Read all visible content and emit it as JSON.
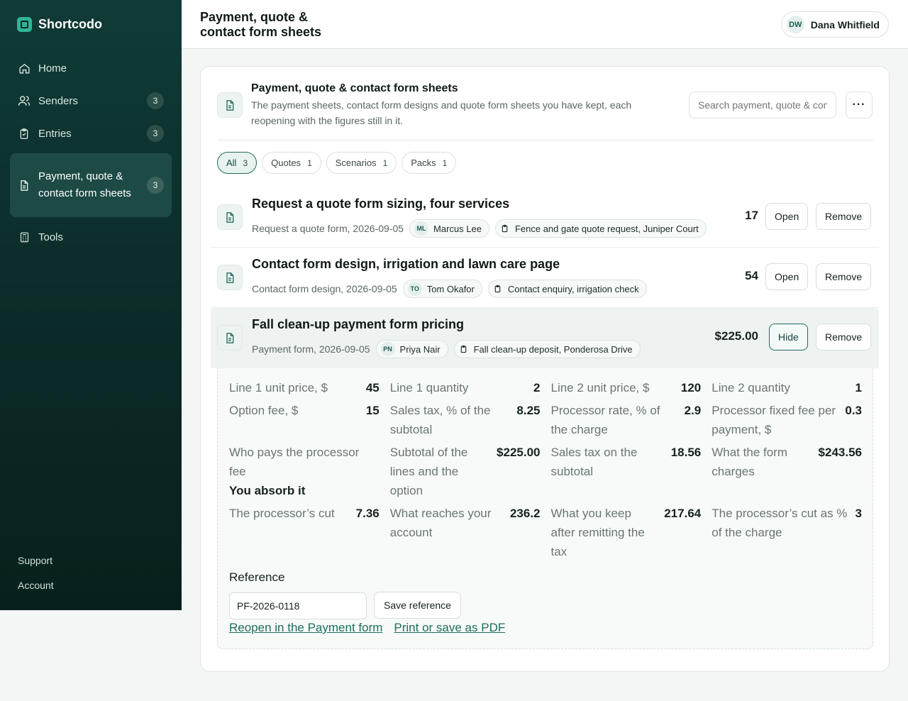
{
  "app": {
    "name": "Shortcodo"
  },
  "sidebar": {
    "items": [
      {
        "label": "Home",
        "icon": "home-icon",
        "badge": null
      },
      {
        "label": "Senders",
        "icon": "users-icon",
        "badge": "3"
      },
      {
        "label": "Entries",
        "icon": "clipboard-icon",
        "badge": "3"
      },
      {
        "label": "Payment, quote & contact form sheets",
        "icon": "document-icon",
        "badge": "3",
        "active": true
      },
      {
        "label": "Tools",
        "icon": "calculator-icon",
        "badge": null
      }
    ],
    "footer": {
      "support": "Support",
      "account": "Account"
    }
  },
  "header": {
    "title": "Payment, quote & contact form sheets",
    "user": {
      "initials": "DW",
      "name": "Dana Whitfield"
    }
  },
  "main": {
    "title": "Payment, quote & contact form sheets",
    "subtitle": "The payment sheets, contact form designs and quote form sheets you have kept, each reopening with the figures still in it.",
    "search_placeholder": "Search payment, quote & contact form sheets",
    "more_label": "···",
    "filters": [
      {
        "label": "All",
        "count": "3",
        "active": true
      },
      {
        "label": "Quotes",
        "count": "1"
      },
      {
        "label": "Scenarios",
        "count": "1"
      },
      {
        "label": "Packs",
        "count": "1"
      }
    ],
    "rows": [
      {
        "title": "Request a quote form sizing, four services",
        "meta": "Request a quote form, 2026-09-05",
        "sender_initials": "ML",
        "sender": "Marcus Lee",
        "entry": "Fence and gate quote request, Juniper Court",
        "amount": "17",
        "primary_action": "Open",
        "secondary_action": "Remove"
      },
      {
        "title": "Contact form design, irrigation and lawn care page",
        "meta": "Contact form design, 2026-09-05",
        "sender_initials": "TO",
        "sender": "Tom Okafor",
        "entry": "Contact enquiry, irrigation check",
        "amount": "54",
        "primary_action": "Open",
        "secondary_action": "Remove"
      },
      {
        "title": "Fall clean-up payment form pricing",
        "meta": "Payment form, 2026-09-05",
        "sender_initials": "PN",
        "sender": "Priya Nair",
        "entry": "Fall clean-up deposit, Ponderosa Drive",
        "amount": "$225.00",
        "primary_action": "Hide",
        "secondary_action": "Remove"
      }
    ],
    "detail": {
      "fields": [
        {
          "k": "Line 1 unit price, $",
          "v": "45"
        },
        {
          "k": "Line 1 quantity",
          "v": "2"
        },
        {
          "k": "Line 2 unit price, $",
          "v": "120"
        },
        {
          "k": "Line 2 quantity",
          "v": "1"
        },
        {
          "k": "Option fee, $",
          "v": "15"
        },
        {
          "k": "Sales tax, % of the subtotal",
          "v": "8.25"
        },
        {
          "k": "Processor rate, % of the charge",
          "v": "2.9"
        },
        {
          "k": "Processor fixed fee per payment, $",
          "v": "0.3"
        },
        {
          "k": "Who pays the processor fee",
          "v": "",
          "strong": "You absorb it"
        },
        {
          "k": "Subtotal of the lines and the option",
          "v": "$225.00"
        },
        {
          "k": "Sales tax on the subtotal",
          "v": "18.56"
        },
        {
          "k": "What the form charges",
          "v": "$243.56"
        },
        {
          "k": "The processor’s cut",
          "v": "7.36"
        },
        {
          "k": "What reaches your account",
          "v": "236.2"
        },
        {
          "k": "What you keep after remitting the tax",
          "v": "217.64"
        },
        {
          "k": "The processor’s cut as % of the charge",
          "v": "3"
        }
      ],
      "reference_label": "Reference",
      "reference_value": "PF-2026-0118",
      "save_reference": "Save reference",
      "reopen_link": "Reopen in the Payment form",
      "print_link": "Print or save as PDF"
    }
  },
  "colors": {
    "accent": "#226a5d",
    "sidebar": "#0f3b36",
    "brand": "#2fb597"
  }
}
